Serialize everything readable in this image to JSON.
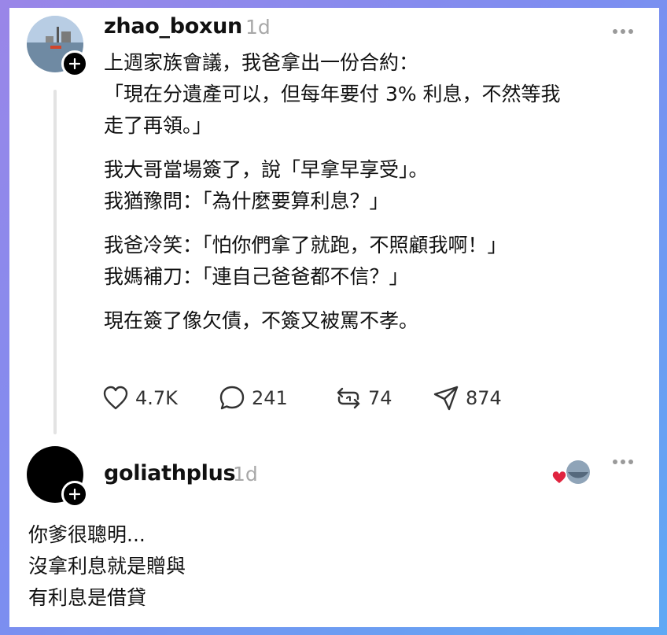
{
  "post": {
    "username": "zhao_boxun",
    "time": "1d",
    "lines": [
      "上週家族會議，我爸拿出一份合約：",
      "「現在分遺產可以，但每年要付 3% 利息，不然等我",
      "走了再領。」",
      "我大哥當場簽了，說「早拿早享受」。",
      "我猶豫問：「為什麼要算利息？」",
      "我爸冷笑：「怕你們拿了就跑，不照顧我啊！」",
      "我媽補刀：「連自己爸爸都不信？」",
      "現在簽了像欠債，不簽又被罵不孝。"
    ],
    "actions": {
      "likes": "4.7K",
      "comments": "241",
      "reposts": "74",
      "shares": "874"
    }
  },
  "reply": {
    "username": "goliathplus",
    "time": "1d",
    "lines": [
      "你爹很聰明...",
      "沒拿利息就是贈與",
      "有利息是借貸"
    ]
  },
  "icons": {
    "follow": "plus-icon",
    "more": "more-horizontal-icon",
    "like": "heart-icon",
    "comment": "speech-bubble-icon",
    "repost": "repost-icon",
    "share": "paper-plane-icon",
    "liked_by_author": "red-heart-icon"
  },
  "colors": {
    "background_gradient_start": "#9a86e8",
    "background_gradient_end": "#5fa9f4",
    "liked_heart": "#e0243f"
  }
}
